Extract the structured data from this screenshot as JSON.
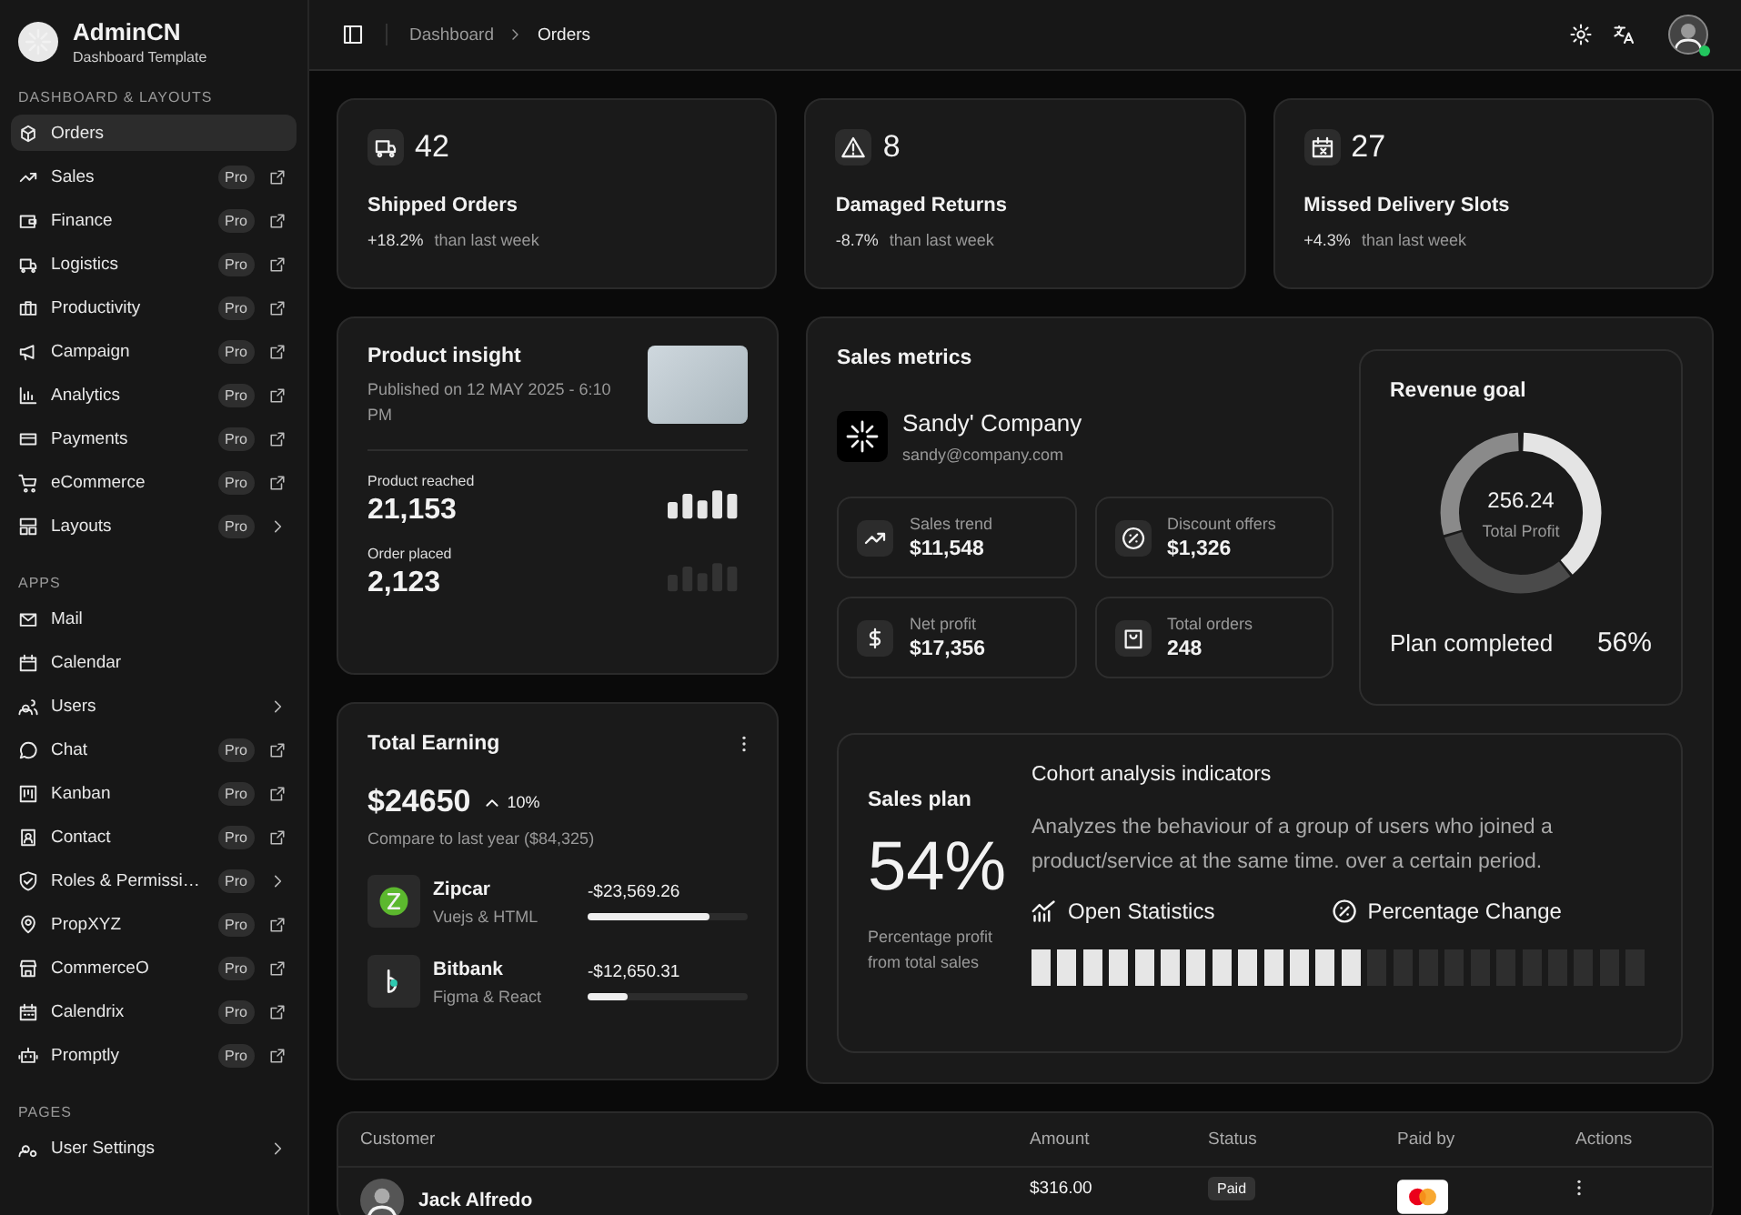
{
  "brand": {
    "name": "AdminCN",
    "subtitle": "Dashboard Template"
  },
  "sidebar": {
    "sections": [
      {
        "title": "DASHBOARD & LAYOUTS",
        "items": [
          {
            "label": "Orders",
            "selected": true,
            "kind": "plain"
          },
          {
            "label": "Sales",
            "selected": false,
            "kind": "external",
            "badge": "Pro"
          },
          {
            "label": "Finance",
            "selected": false,
            "kind": "external",
            "badge": "Pro"
          },
          {
            "label": "Logistics",
            "selected": false,
            "kind": "external",
            "badge": "Pro"
          },
          {
            "label": "Productivity",
            "selected": false,
            "kind": "external",
            "badge": "Pro"
          },
          {
            "label": "Campaign",
            "selected": false,
            "kind": "external",
            "badge": "Pro"
          },
          {
            "label": "Analytics",
            "selected": false,
            "kind": "external",
            "badge": "Pro"
          },
          {
            "label": "Payments",
            "selected": false,
            "kind": "external",
            "badge": "Pro"
          },
          {
            "label": "eCommerce",
            "selected": false,
            "kind": "external",
            "badge": "Pro"
          },
          {
            "label": "Layouts",
            "selected": false,
            "kind": "submenu",
            "badge": "Pro"
          }
        ]
      },
      {
        "title": "APPS",
        "items": [
          {
            "label": "Mail",
            "selected": false,
            "kind": "plain"
          },
          {
            "label": "Calendar",
            "selected": false,
            "kind": "plain"
          },
          {
            "label": "Users",
            "selected": false,
            "kind": "submenu"
          },
          {
            "label": "Chat",
            "selected": false,
            "kind": "external",
            "badge": "Pro"
          },
          {
            "label": "Kanban",
            "selected": false,
            "kind": "external",
            "badge": "Pro"
          },
          {
            "label": "Contact",
            "selected": false,
            "kind": "external",
            "badge": "Pro"
          },
          {
            "label": "Roles & Permissi…",
            "selected": false,
            "kind": "submenu",
            "badge": "Pro"
          },
          {
            "label": "PropXYZ",
            "selected": false,
            "kind": "external",
            "badge": "Pro"
          },
          {
            "label": "CommerceO",
            "selected": false,
            "kind": "external",
            "badge": "Pro"
          },
          {
            "label": "Calendrix",
            "selected": false,
            "kind": "external",
            "badge": "Pro"
          },
          {
            "label": "Promptly",
            "selected": false,
            "kind": "external",
            "badge": "Pro"
          }
        ]
      },
      {
        "title": "PAGES",
        "items": [
          {
            "label": "User Settings",
            "selected": false,
            "kind": "submenu"
          }
        ]
      }
    ]
  },
  "header": {
    "breadcrumb": [
      "Dashboard",
      "Orders"
    ],
    "user_online": true
  },
  "stats": [
    {
      "value": "42",
      "label": "Shipped Orders",
      "change": "+18.2%",
      "note": "than last week"
    },
    {
      "value": "8",
      "label": "Damaged Returns",
      "change": "-8.7%",
      "note": "than last week"
    },
    {
      "value": "27",
      "label": "Missed Delivery Slots",
      "change": "+4.3%",
      "note": "than last week"
    }
  ],
  "insight": {
    "title": "Product insight",
    "published": "Published on 12 MAY 2025 - 6:10 PM",
    "metrics": [
      {
        "label": "Product reached",
        "value": "21,153",
        "active": true
      },
      {
        "label": "Order placed",
        "value": "2,123",
        "active": false
      }
    ]
  },
  "earning": {
    "title": "Total Earning",
    "amount": "$24650",
    "change": "10%",
    "compare": "Compare to last year ($84,325)",
    "items": [
      {
        "name": "Zipcar",
        "stack": "Vuejs & HTML",
        "amount": "-$23,569.26",
        "level": 0.76
      },
      {
        "name": "Bitbank",
        "stack": "Figma & React",
        "amount": "-$12,650.31",
        "level": 0.25
      }
    ]
  },
  "sales_metrics": {
    "title": "Sales metrics",
    "company": {
      "name": "Sandy' Company",
      "email": "sandy@company.com"
    },
    "tiles": [
      {
        "label": "Sales trend",
        "value": "$11,548"
      },
      {
        "label": "Discount offers",
        "value": "$1,326"
      },
      {
        "label": "Net profit",
        "value": "$17,356"
      },
      {
        "label": "Total orders",
        "value": "248"
      }
    ],
    "revenue_goal": {
      "title": "Revenue goal",
      "center_value": "256.24",
      "center_label": "Total Profit",
      "plan_label": "Plan completed",
      "plan_value": "56%"
    },
    "sales_plan": {
      "title": "Sales plan",
      "value": "54%",
      "caption": "Percentage profit from total sales"
    },
    "cohort": {
      "title": "Cohort analysis indicators",
      "description": "Analyzes the behaviour of a group of users who joined a product/service at the same time. over a certain period.",
      "links": [
        "Open Statistics",
        "Percentage Change"
      ],
      "level": 0.54
    }
  },
  "table": {
    "columns": [
      "Customer",
      "Amount",
      "Status",
      "Paid by",
      "Actions"
    ],
    "rows": [
      {
        "customer": "Jack Alfredo",
        "amount": "$316.00",
        "status": "Paid"
      }
    ]
  }
}
